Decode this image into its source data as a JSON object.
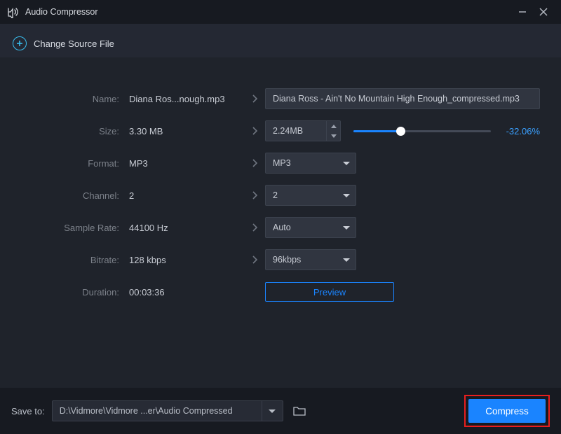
{
  "app": {
    "title": "Audio Compressor"
  },
  "source": {
    "change_label": "Change Source File"
  },
  "fields": {
    "name": {
      "label": "Name:",
      "value": "Diana Ros...nough.mp3",
      "output": "Diana Ross - Ain't No Mountain High Enough_compressed.mp3"
    },
    "size": {
      "label": "Size:",
      "value": "3.30 MB",
      "output": "2.24MB",
      "percent": "-32.06%",
      "slider_fill_pct": 34
    },
    "format": {
      "label": "Format:",
      "value": "MP3",
      "output": "MP3"
    },
    "channel": {
      "label": "Channel:",
      "value": "2",
      "output": "2"
    },
    "sampleRate": {
      "label": "Sample Rate:",
      "value": "44100 Hz",
      "output": "Auto"
    },
    "bitrate": {
      "label": "Bitrate:",
      "value": "128 kbps",
      "output": "96kbps"
    },
    "duration": {
      "label": "Duration:",
      "value": "00:03:36"
    }
  },
  "buttons": {
    "preview": "Preview",
    "compress": "Compress"
  },
  "save": {
    "label": "Save to:",
    "path": "D:\\Vidmore\\Vidmore ...er\\Audio Compressed"
  }
}
